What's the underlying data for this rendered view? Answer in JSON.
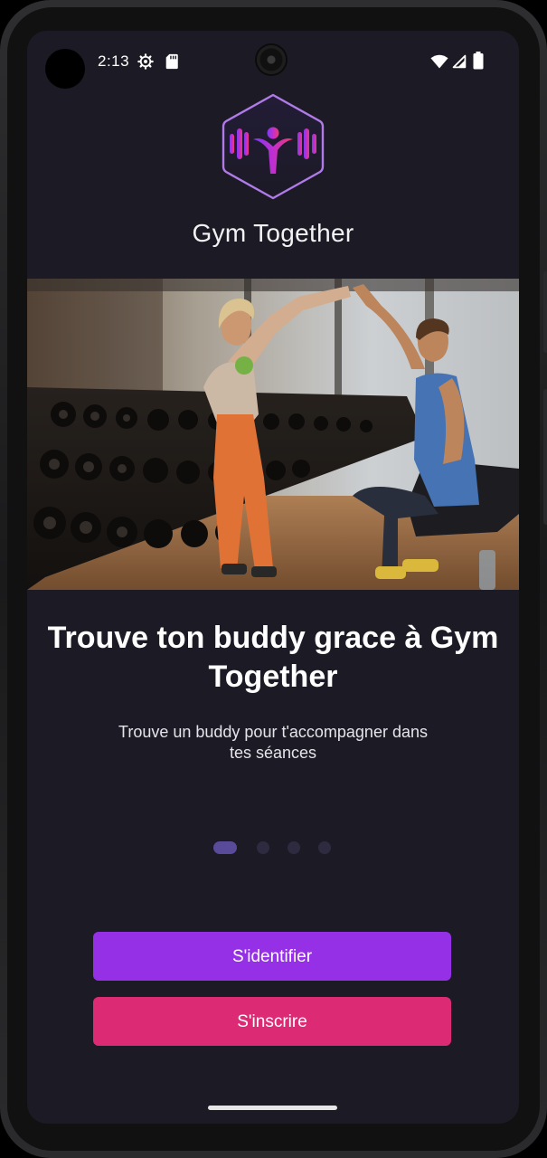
{
  "status_bar": {
    "time": "2:13",
    "icons": [
      "settings-gear-icon",
      "sd-card-icon",
      "wifi-icon",
      "cell-signal-icon",
      "battery-icon"
    ]
  },
  "app": {
    "name": "Gym Together",
    "logo_icon": "dumbbell-people-hexagon-logo"
  },
  "hero_image": {
    "subject": "gym-partners-high-five-photo"
  },
  "slide": {
    "title": "Trouve ton buddy grace à Gym Together",
    "subtitle": "Trouve un buddy pour t'accompagner dans tes séances"
  },
  "pager": {
    "count": 4,
    "active_index": 0
  },
  "actions": {
    "login_label": "S'identifier",
    "signup_label": "S'inscrire"
  },
  "colors": {
    "background": "#1c1a24",
    "login_button": "#9530e6",
    "signup_button": "#dc2a74",
    "logo_border": "#b07be8",
    "dot_active": "#5a4a9a",
    "dot_inactive": "#2e2b40"
  }
}
